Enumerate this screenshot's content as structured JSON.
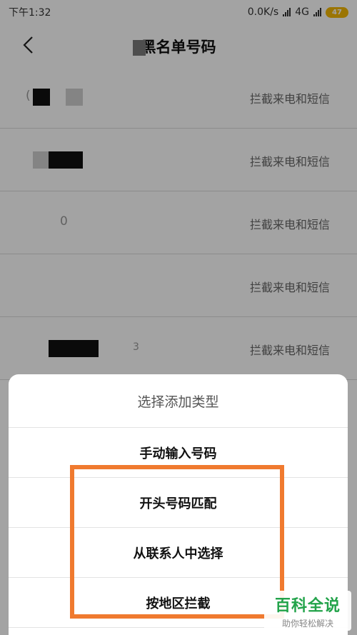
{
  "status_bar": {
    "time": "下午1:32",
    "net_speed": "0.0K/s",
    "network": "4G",
    "battery": "47"
  },
  "header": {
    "title": "黑名单号码",
    "back_icon": "chevron-left-icon"
  },
  "list": {
    "rows": [
      {
        "action": "拦截来电和短信",
        "visible_text": "("
      },
      {
        "action": "拦截来电和短信",
        "visible_text": ""
      },
      {
        "action": "拦截来电和短信",
        "visible_text": "0"
      },
      {
        "action": "拦截来电和短信",
        "visible_text": ""
      },
      {
        "action": "拦截来电和短信",
        "visible_text": "3"
      }
    ]
  },
  "sheet": {
    "title": "选择添加类型",
    "items": [
      {
        "label": "手动输入号码"
      },
      {
        "label": "开头号码匹配"
      },
      {
        "label": "从联系人中选择"
      },
      {
        "label": "按地区拦截"
      }
    ]
  },
  "highlight": {
    "color": "#f07a2f"
  },
  "watermark": {
    "brand": "百科全说",
    "slogan": "助你轻松解决"
  }
}
